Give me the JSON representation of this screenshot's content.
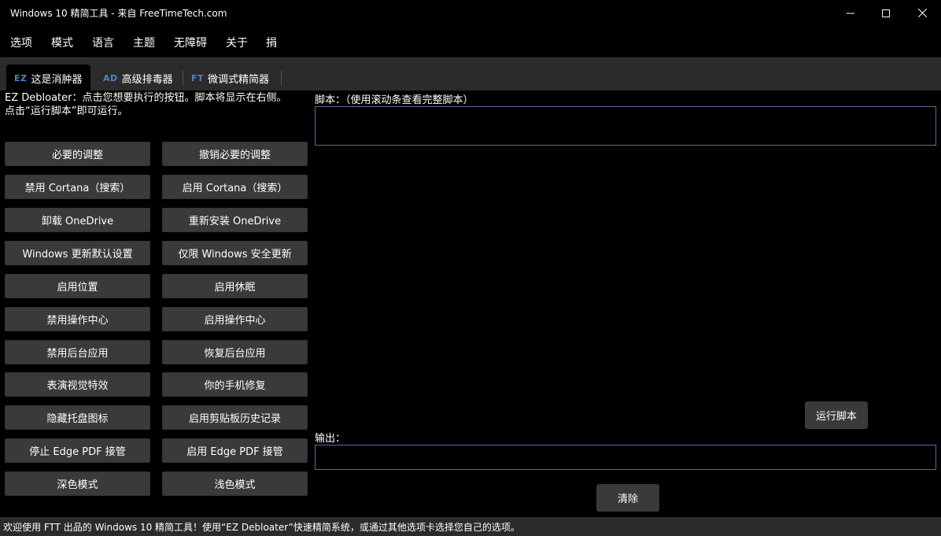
{
  "window": {
    "title": "Windows 10 精简工具 - 来自 FreeTimeTech.com",
    "controls": {
      "minimize_icon": "minimize-icon",
      "maximize_icon": "maximize-icon",
      "close_icon": "close-icon"
    }
  },
  "menu": [
    "选项",
    "模式",
    "语言",
    "主题",
    "无障碍",
    "关于",
    "捐"
  ],
  "tabs": [
    {
      "badge": "EZ",
      "label": "这是消肿器",
      "active": true
    },
    {
      "badge": "AD",
      "label": "高级排毒器",
      "active": false
    },
    {
      "badge": "FT",
      "label": "微调式精简器",
      "active": false
    }
  ],
  "intro": {
    "line1": "EZ Debloater：点击您想要执行的按钮。脚本将显示在右侧。",
    "line2": "点击“运行脚本”即可运行。"
  },
  "buttons": [
    {
      "left": "必要的调整",
      "right": "撤销必要的调整"
    },
    {
      "left": "禁用 Cortana（搜索）",
      "right": "启用 Cortana（搜索）"
    },
    {
      "left": "卸载 OneDrive",
      "right": "重新安装 OneDrive"
    },
    {
      "left": "Windows 更新默认设置",
      "right": "仅限 Windows 安全更新"
    },
    {
      "left": "启用位置",
      "right": "启用休眠"
    },
    {
      "left": "禁用操作中心",
      "right": "启用操作中心"
    },
    {
      "left": "禁用后台应用",
      "right": "恢复后台应用"
    },
    {
      "left": "表演视觉特效",
      "right": "你的手机修复"
    },
    {
      "left": "隐藏托盘图标",
      "right": "启用剪贴板历史记录"
    },
    {
      "left": "停止 Edge PDF 接管",
      "right": "启用 Edge PDF 接管"
    },
    {
      "left": "深色模式",
      "right": "浅色模式"
    }
  ],
  "script": {
    "label": "脚本：（使用滚动条查看完整脚本）",
    "value": ""
  },
  "run_button": "运行脚本",
  "output": {
    "label": "输出：",
    "value": ""
  },
  "clear_button": "清除",
  "status": "欢迎使用 FTT 出品的 Windows 10 精简工具！使用“EZ Debloater”快速精简系统，或通过其他选项卡选择您自己的选项。",
  "colors": {
    "accent_badge": "#4a86c8",
    "input_border": "#5a6b96",
    "button_bg": "#3a3a3a",
    "chrome_bg": "#2b2b2b"
  }
}
